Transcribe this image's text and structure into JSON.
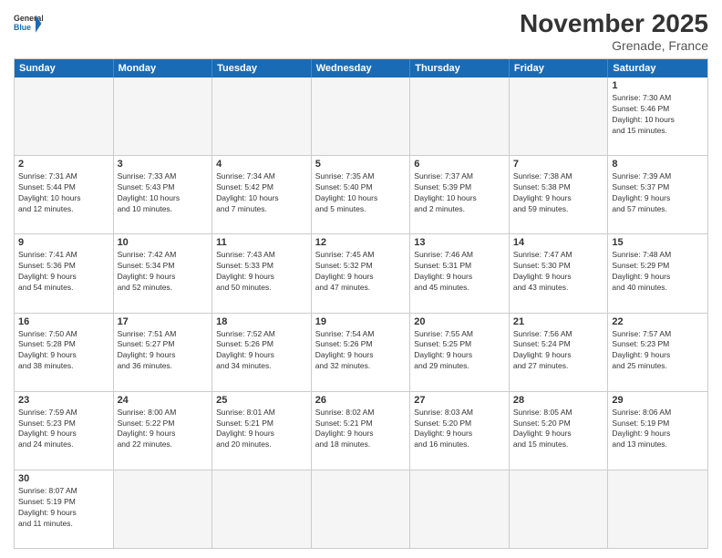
{
  "header": {
    "logo_general": "General",
    "logo_blue": "Blue",
    "month_title": "November 2025",
    "location": "Grenade, France"
  },
  "weekdays": [
    "Sunday",
    "Monday",
    "Tuesday",
    "Wednesday",
    "Thursday",
    "Friday",
    "Saturday"
  ],
  "weeks": [
    [
      {
        "day": "",
        "info": ""
      },
      {
        "day": "",
        "info": ""
      },
      {
        "day": "",
        "info": ""
      },
      {
        "day": "",
        "info": ""
      },
      {
        "day": "",
        "info": ""
      },
      {
        "day": "",
        "info": ""
      },
      {
        "day": "1",
        "info": "Sunrise: 7:30 AM\nSunset: 5:46 PM\nDaylight: 10 hours\nand 15 minutes."
      }
    ],
    [
      {
        "day": "2",
        "info": "Sunrise: 7:31 AM\nSunset: 5:44 PM\nDaylight: 10 hours\nand 12 minutes."
      },
      {
        "day": "3",
        "info": "Sunrise: 7:33 AM\nSunset: 5:43 PM\nDaylight: 10 hours\nand 10 minutes."
      },
      {
        "day": "4",
        "info": "Sunrise: 7:34 AM\nSunset: 5:42 PM\nDaylight: 10 hours\nand 7 minutes."
      },
      {
        "day": "5",
        "info": "Sunrise: 7:35 AM\nSunset: 5:40 PM\nDaylight: 10 hours\nand 5 minutes."
      },
      {
        "day": "6",
        "info": "Sunrise: 7:37 AM\nSunset: 5:39 PM\nDaylight: 10 hours\nand 2 minutes."
      },
      {
        "day": "7",
        "info": "Sunrise: 7:38 AM\nSunset: 5:38 PM\nDaylight: 9 hours\nand 59 minutes."
      },
      {
        "day": "8",
        "info": "Sunrise: 7:39 AM\nSunset: 5:37 PM\nDaylight: 9 hours\nand 57 minutes."
      }
    ],
    [
      {
        "day": "9",
        "info": "Sunrise: 7:41 AM\nSunset: 5:36 PM\nDaylight: 9 hours\nand 54 minutes."
      },
      {
        "day": "10",
        "info": "Sunrise: 7:42 AM\nSunset: 5:34 PM\nDaylight: 9 hours\nand 52 minutes."
      },
      {
        "day": "11",
        "info": "Sunrise: 7:43 AM\nSunset: 5:33 PM\nDaylight: 9 hours\nand 50 minutes."
      },
      {
        "day": "12",
        "info": "Sunrise: 7:45 AM\nSunset: 5:32 PM\nDaylight: 9 hours\nand 47 minutes."
      },
      {
        "day": "13",
        "info": "Sunrise: 7:46 AM\nSunset: 5:31 PM\nDaylight: 9 hours\nand 45 minutes."
      },
      {
        "day": "14",
        "info": "Sunrise: 7:47 AM\nSunset: 5:30 PM\nDaylight: 9 hours\nand 43 minutes."
      },
      {
        "day": "15",
        "info": "Sunrise: 7:48 AM\nSunset: 5:29 PM\nDaylight: 9 hours\nand 40 minutes."
      }
    ],
    [
      {
        "day": "16",
        "info": "Sunrise: 7:50 AM\nSunset: 5:28 PM\nDaylight: 9 hours\nand 38 minutes."
      },
      {
        "day": "17",
        "info": "Sunrise: 7:51 AM\nSunset: 5:27 PM\nDaylight: 9 hours\nand 36 minutes."
      },
      {
        "day": "18",
        "info": "Sunrise: 7:52 AM\nSunset: 5:26 PM\nDaylight: 9 hours\nand 34 minutes."
      },
      {
        "day": "19",
        "info": "Sunrise: 7:54 AM\nSunset: 5:26 PM\nDaylight: 9 hours\nand 32 minutes."
      },
      {
        "day": "20",
        "info": "Sunrise: 7:55 AM\nSunset: 5:25 PM\nDaylight: 9 hours\nand 29 minutes."
      },
      {
        "day": "21",
        "info": "Sunrise: 7:56 AM\nSunset: 5:24 PM\nDaylight: 9 hours\nand 27 minutes."
      },
      {
        "day": "22",
        "info": "Sunrise: 7:57 AM\nSunset: 5:23 PM\nDaylight: 9 hours\nand 25 minutes."
      }
    ],
    [
      {
        "day": "23",
        "info": "Sunrise: 7:59 AM\nSunset: 5:23 PM\nDaylight: 9 hours\nand 24 minutes."
      },
      {
        "day": "24",
        "info": "Sunrise: 8:00 AM\nSunset: 5:22 PM\nDaylight: 9 hours\nand 22 minutes."
      },
      {
        "day": "25",
        "info": "Sunrise: 8:01 AM\nSunset: 5:21 PM\nDaylight: 9 hours\nand 20 minutes."
      },
      {
        "day": "26",
        "info": "Sunrise: 8:02 AM\nSunset: 5:21 PM\nDaylight: 9 hours\nand 18 minutes."
      },
      {
        "day": "27",
        "info": "Sunrise: 8:03 AM\nSunset: 5:20 PM\nDaylight: 9 hours\nand 16 minutes."
      },
      {
        "day": "28",
        "info": "Sunrise: 8:05 AM\nSunset: 5:20 PM\nDaylight: 9 hours\nand 15 minutes."
      },
      {
        "day": "29",
        "info": "Sunrise: 8:06 AM\nSunset: 5:19 PM\nDaylight: 9 hours\nand 13 minutes."
      }
    ],
    [
      {
        "day": "30",
        "info": "Sunrise: 8:07 AM\nSunset: 5:19 PM\nDaylight: 9 hours\nand 11 minutes."
      },
      {
        "day": "",
        "info": ""
      },
      {
        "day": "",
        "info": ""
      },
      {
        "day": "",
        "info": ""
      },
      {
        "day": "",
        "info": ""
      },
      {
        "day": "",
        "info": ""
      },
      {
        "day": "",
        "info": ""
      }
    ]
  ]
}
